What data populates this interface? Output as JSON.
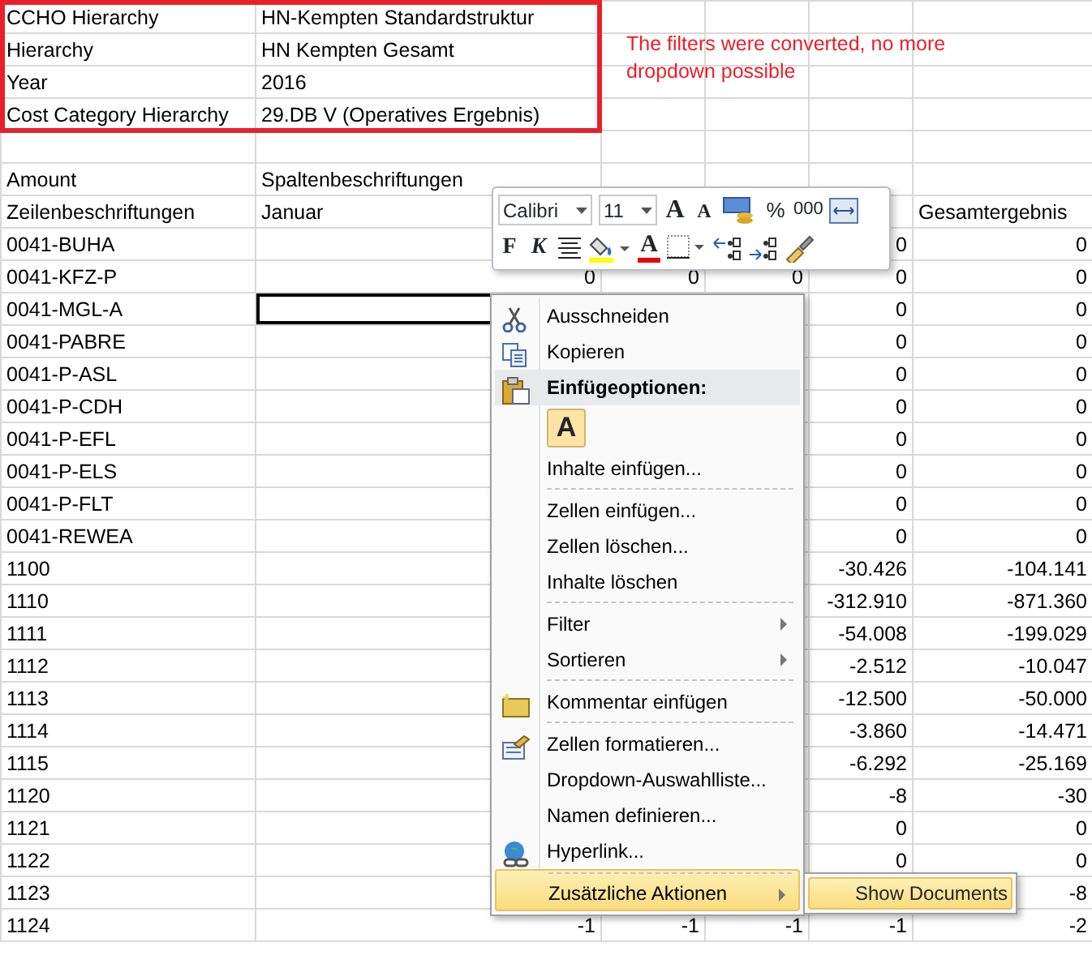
{
  "filters": [
    {
      "label": "CCHO Hierarchy",
      "value": "HN-Kempten Standardstruktur"
    },
    {
      "label": "Hierarchy",
      "value": "HN Kempten Gesamt"
    },
    {
      "label": "Year",
      "value": "2016"
    },
    {
      "label": "Cost Category Hierarchy",
      "value": "29.DB V (Operatives Ergebnis)"
    }
  ],
  "note": "The filters were converted, no more dropdown possible",
  "pivot": {
    "value_label": "Amount",
    "column_labels": "Spaltenbeschriftungen",
    "row_labels": "Zeilenbeschriftungen",
    "januar": "Januar",
    "gesamtergebnis": "Gesamtergebnis"
  },
  "rows": [
    {
      "label": "0041-BUHA",
      "selected": false,
      "column_5": "0",
      "gesamtergebnis": "0"
    },
    {
      "label": "0041-KFZ-P",
      "selected": false,
      "januar": "0",
      "column_3": "0",
      "column_4": "0",
      "column_5": "0",
      "gesamtergebnis": "0"
    },
    {
      "label": "0041-MGL-A",
      "selected": true,
      "column_5": "0",
      "gesamtergebnis": "0"
    },
    {
      "label": "0041-PABRE",
      "selected": false,
      "column_5": "0",
      "gesamtergebnis": "0"
    },
    {
      "label": "0041-P-ASL",
      "selected": false,
      "column_5": "0",
      "gesamtergebnis": "0"
    },
    {
      "label": "0041-P-CDH",
      "selected": false,
      "column_5": "0",
      "gesamtergebnis": "0"
    },
    {
      "label": "0041-P-EFL",
      "selected": false,
      "column_5": "0",
      "gesamtergebnis": "0"
    },
    {
      "label": "0041-P-ELS",
      "selected": false,
      "column_5": "0",
      "gesamtergebnis": "0"
    },
    {
      "label": "0041-P-FLT",
      "selected": false,
      "column_5": "0",
      "gesamtergebnis": "0"
    },
    {
      "label": "0041-REWEA",
      "selected": false,
      "column_5": "0",
      "gesamtergebnis": "0"
    },
    {
      "label": "1100",
      "selected": false,
      "column_5": "-30.426",
      "gesamtergebnis": "-104.141"
    },
    {
      "label": "1110",
      "selected": false,
      "column_5": "-312.910",
      "gesamtergebnis": "-871.360"
    },
    {
      "label": "1111",
      "selected": false,
      "column_5": "-54.008",
      "gesamtergebnis": "-199.029"
    },
    {
      "label": "1112",
      "selected": false,
      "column_5": "-2.512",
      "gesamtergebnis": "-10.047"
    },
    {
      "label": "1113",
      "selected": false,
      "column_5": "-12.500",
      "gesamtergebnis": "-50.000"
    },
    {
      "label": "1114",
      "selected": false,
      "column_5": "-3.860",
      "gesamtergebnis": "-14.471"
    },
    {
      "label": "1115",
      "selected": false,
      "column_5": "-6.292",
      "gesamtergebnis": "-25.169"
    },
    {
      "label": "1120",
      "selected": false,
      "column_5": "-8",
      "gesamtergebnis": "-30"
    },
    {
      "label": "1121",
      "selected": false,
      "column_5": "0",
      "gesamtergebnis": "0"
    },
    {
      "label": "1122",
      "selected": false,
      "column_5": "0",
      "gesamtergebnis": "0"
    },
    {
      "label": "1123",
      "selected": false,
      "gesamtergebnis": "-8"
    },
    {
      "label": "1124",
      "selected": false,
      "januar": "-1",
      "column_3": "-1",
      "column_4": "-1",
      "column_5": "-1",
      "gesamtergebnis": "-2"
    }
  ],
  "mini_toolbar": {
    "font": "Calibri",
    "size": "11",
    "grow": "A",
    "shrink": "A",
    "percent": "%",
    "thousands": "000",
    "bold": "F",
    "italic": "K",
    "font_color": "A"
  },
  "context_menu": [
    {
      "kind": "cut",
      "label": "Ausschneiden",
      "selected": false
    },
    {
      "kind": "copy",
      "label": "Kopieren",
      "selected": false
    },
    {
      "kind": "header",
      "label": "Einfügeoptionen:",
      "selected": false
    },
    {
      "kind": "paste-option",
      "label": "A"
    },
    {
      "kind": "plain",
      "label": "Inhalte einfügen...",
      "selected": false
    },
    {
      "kind": "plain",
      "label": "Zellen einfügen...",
      "selected": false,
      "separator_before": true
    },
    {
      "kind": "plain",
      "label": "Zellen löschen...",
      "selected": false
    },
    {
      "kind": "plain",
      "label": "Inhalte löschen",
      "selected": false
    },
    {
      "kind": "submenu",
      "label": "Filter",
      "selected": false,
      "separator_before": true
    },
    {
      "kind": "submenu",
      "label": "Sortieren",
      "selected": false
    },
    {
      "kind": "comment",
      "label": "Kommentar einfügen",
      "selected": false,
      "separator_before": true
    },
    {
      "kind": "format",
      "label": "Zellen formatieren...",
      "selected": false,
      "separator_before": true
    },
    {
      "kind": "plain",
      "label": "Dropdown-Auswahlliste...",
      "selected": false
    },
    {
      "kind": "plain",
      "label": "Namen definieren...",
      "selected": false
    },
    {
      "kind": "hyperlink",
      "label": "Hyperlink...",
      "selected": false
    },
    {
      "kind": "submenu",
      "label": "Zusätzliche Aktionen",
      "selected": true,
      "separator_before": true,
      "submenu": [
        {
          "label": "Show Documents",
          "selected": true
        }
      ]
    }
  ]
}
